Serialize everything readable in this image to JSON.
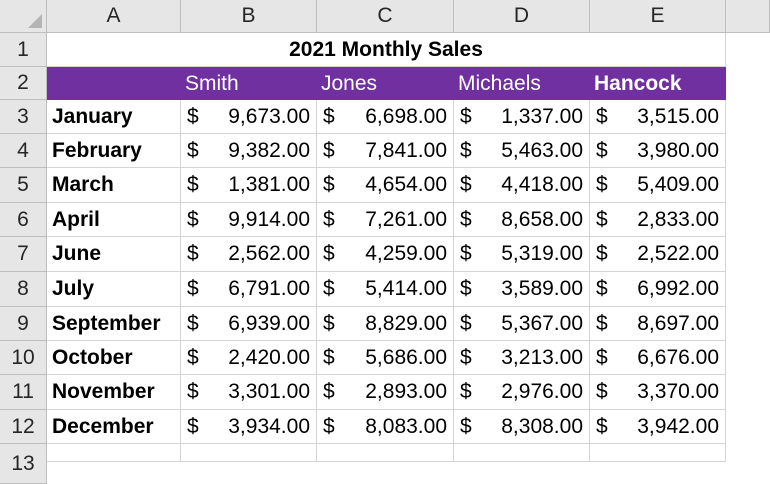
{
  "sheet": {
    "columns": [
      "A",
      "B",
      "C",
      "D",
      "E"
    ],
    "rows": [
      "1",
      "2",
      "3",
      "4",
      "5",
      "6",
      "7",
      "8",
      "9",
      "10",
      "11",
      "12",
      "13"
    ],
    "title": "2021 Monthly Sales",
    "header_bg": "#7030a0",
    "headers": [
      "Smith",
      "Jones",
      "Michaels",
      "Hancock"
    ],
    "currency_symbol": "$",
    "data": [
      {
        "month": "January",
        "values": [
          "9,673.00",
          "6,698.00",
          "1,337.00",
          "3,515.00"
        ]
      },
      {
        "month": "February",
        "values": [
          "9,382.00",
          "7,841.00",
          "5,463.00",
          "3,980.00"
        ]
      },
      {
        "month": "March",
        "values": [
          "1,381.00",
          "4,654.00",
          "4,418.00",
          "5,409.00"
        ]
      },
      {
        "month": "April",
        "values": [
          "9,914.00",
          "7,261.00",
          "8,658.00",
          "2,833.00"
        ]
      },
      {
        "month": "June",
        "values": [
          "2,562.00",
          "4,259.00",
          "5,319.00",
          "2,522.00"
        ]
      },
      {
        "month": "July",
        "values": [
          "6,791.00",
          "5,414.00",
          "3,589.00",
          "6,992.00"
        ]
      },
      {
        "month": "September",
        "values": [
          "6,939.00",
          "8,829.00",
          "5,367.00",
          "8,697.00"
        ]
      },
      {
        "month": "October",
        "values": [
          "2,420.00",
          "5,686.00",
          "3,213.00",
          "6,676.00"
        ]
      },
      {
        "month": "November",
        "values": [
          "3,301.00",
          "2,893.00",
          "2,976.00",
          "3,370.00"
        ]
      },
      {
        "month": "December",
        "values": [
          "3,934.00",
          "8,083.00",
          "8,308.00",
          "3,942.00"
        ]
      }
    ]
  }
}
